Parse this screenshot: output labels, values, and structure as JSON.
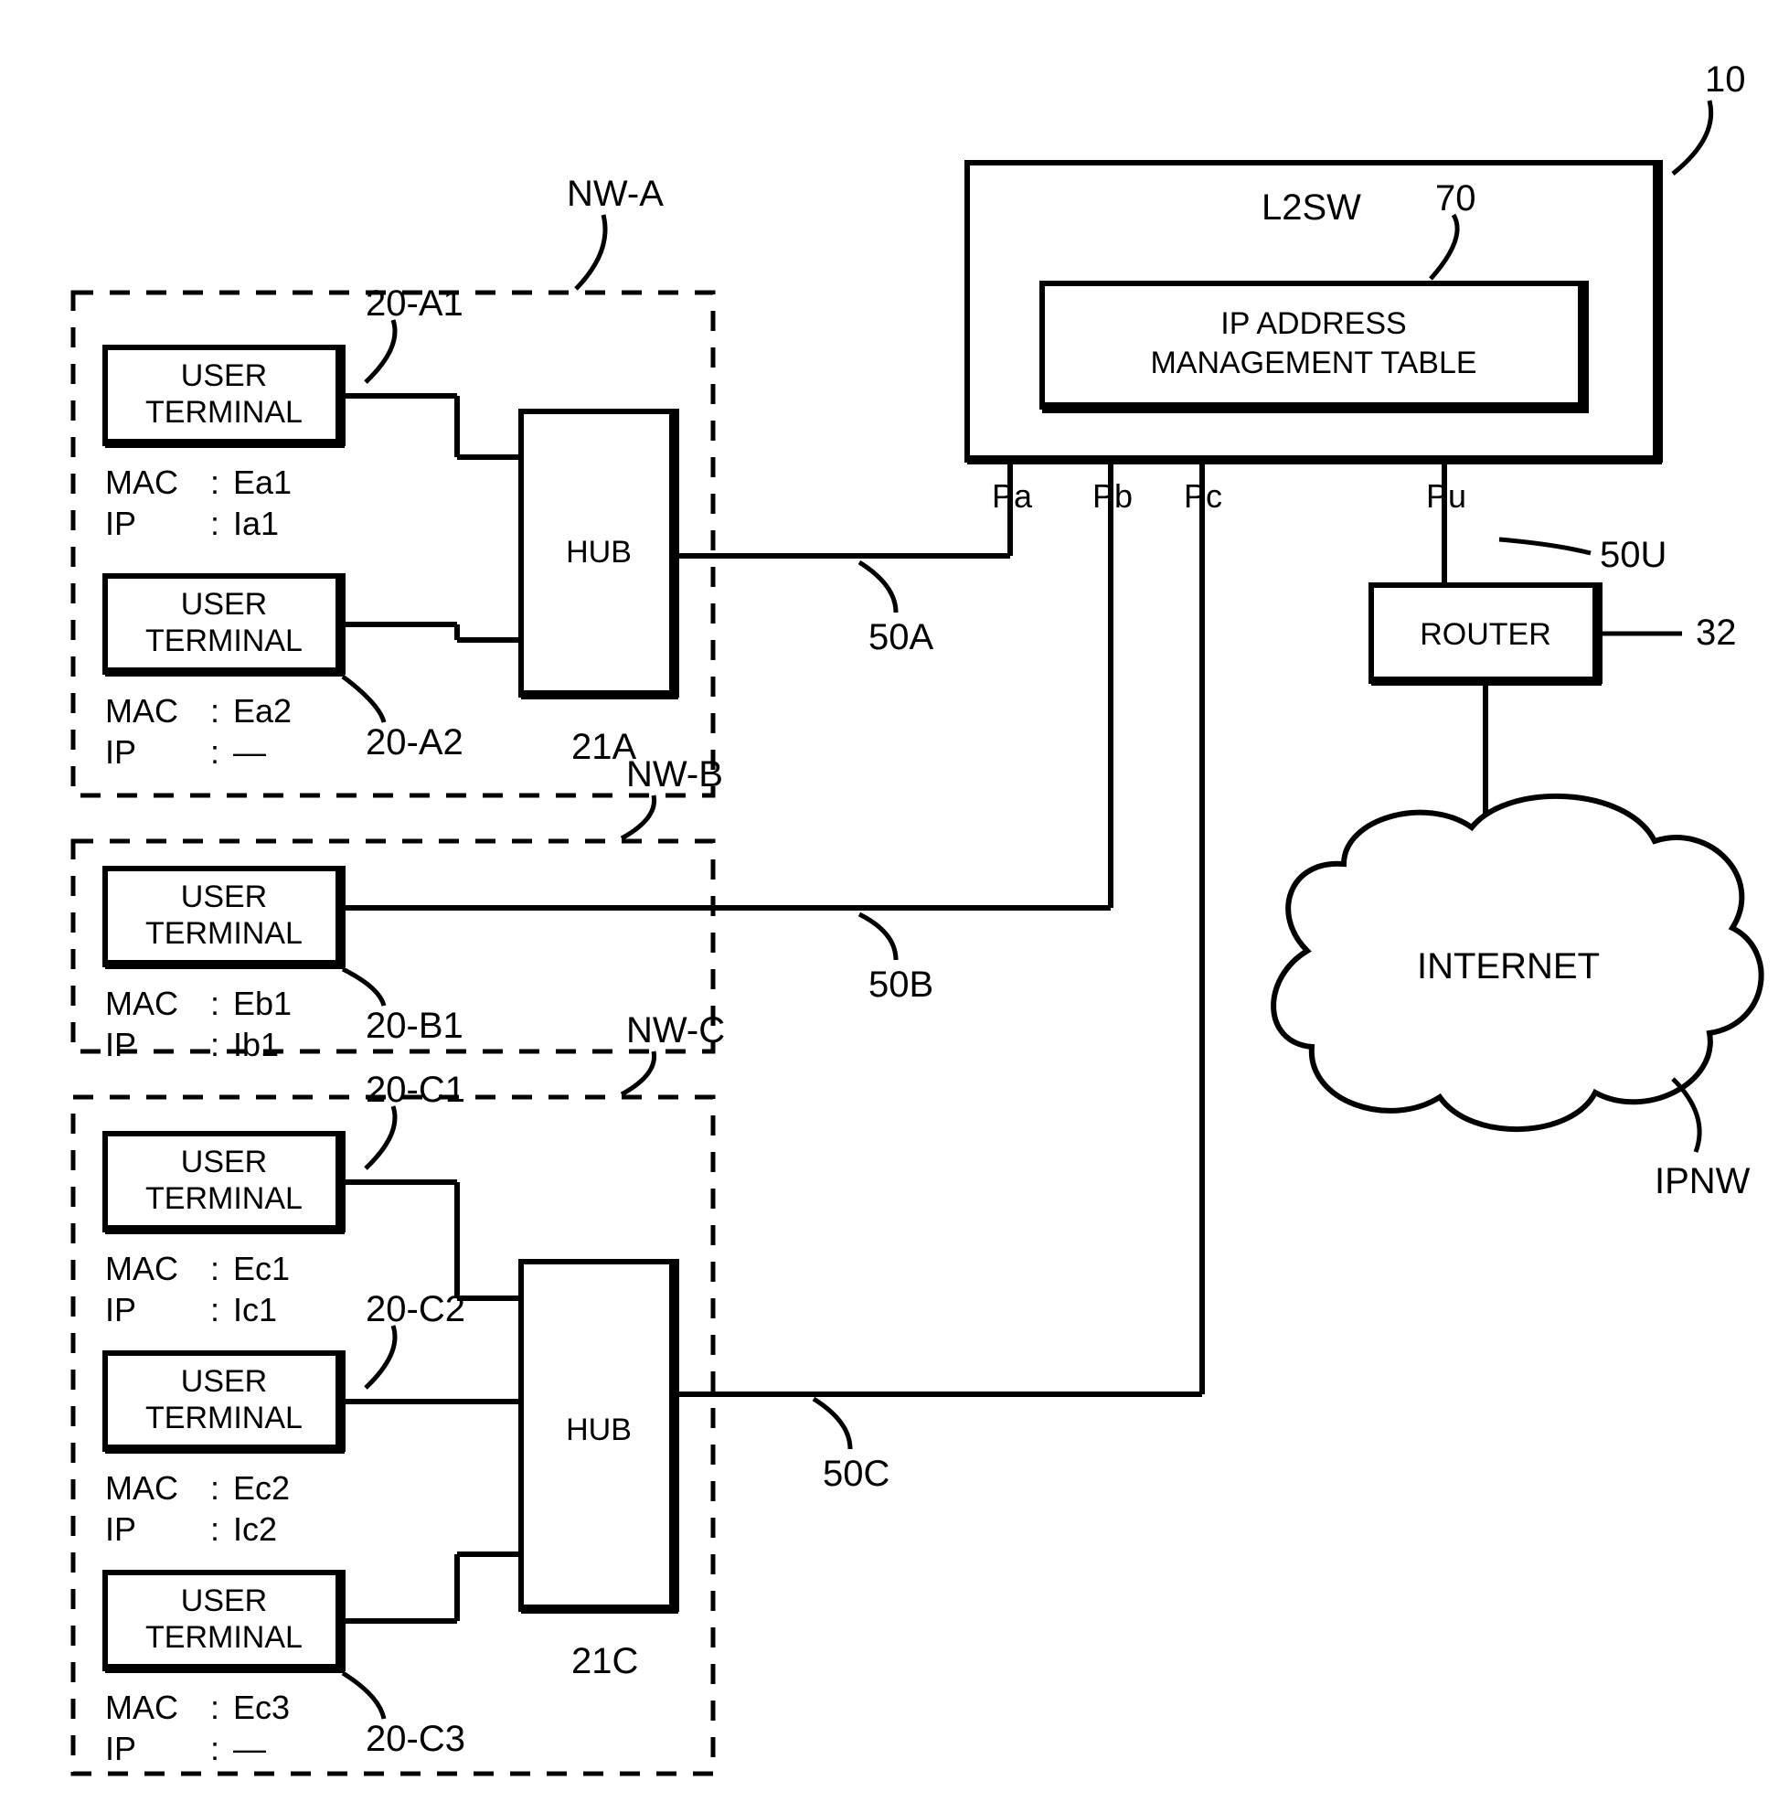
{
  "networks": {
    "nwA": {
      "label": "NW-A",
      "hub": {
        "label": "HUB",
        "ref": "21A"
      },
      "link": "50A",
      "terminals": [
        {
          "label": "USER\nTERMINAL",
          "ref": "20-A1",
          "mac_label": "MAC",
          "mac": "Ea1",
          "ip_label": "IP",
          "ip": "Ia1"
        },
        {
          "label": "USER\nTERMINAL",
          "ref": "20-A2",
          "mac_label": "MAC",
          "mac": "Ea2",
          "ip_label": "IP",
          "ip": "—"
        }
      ]
    },
    "nwB": {
      "label": "NW-B",
      "link": "50B",
      "terminals": [
        {
          "label": "USER\nTERMINAL",
          "ref": "20-B1",
          "mac_label": "MAC",
          "mac": "Eb1",
          "ip_label": "IP",
          "ip": "Ib1"
        }
      ]
    },
    "nwC": {
      "label": "NW-C",
      "hub": {
        "label": "HUB",
        "ref": "21C"
      },
      "link": "50C",
      "terminals": [
        {
          "label": "USER\nTERMINAL",
          "ref": "20-C1",
          "mac_label": "MAC",
          "mac": "Ec1",
          "ip_label": "IP",
          "ip": "Ic1"
        },
        {
          "label": "USER\nTERMINAL",
          "ref": "20-C2",
          "mac_label": "MAC",
          "mac": "Ec2",
          "ip_label": "IP",
          "ip": "Ic2"
        },
        {
          "label": "USER\nTERMINAL",
          "ref": "20-C3",
          "mac_label": "MAC",
          "mac": "Ec3",
          "ip_label": "IP",
          "ip": "—"
        }
      ]
    }
  },
  "switch": {
    "label": "L2SW",
    "ref": "10",
    "table": {
      "label": "IP ADDRESS\nMANAGEMENT TABLE",
      "ref": "70"
    },
    "ports": {
      "pa": "Pa",
      "pb": "Pb",
      "pc": "Pc",
      "pu": "Pu"
    }
  },
  "router": {
    "label": "ROUTER",
    "ref": "32",
    "link": "50U"
  },
  "internet": {
    "label": "INTERNET",
    "ref": "IPNW"
  }
}
